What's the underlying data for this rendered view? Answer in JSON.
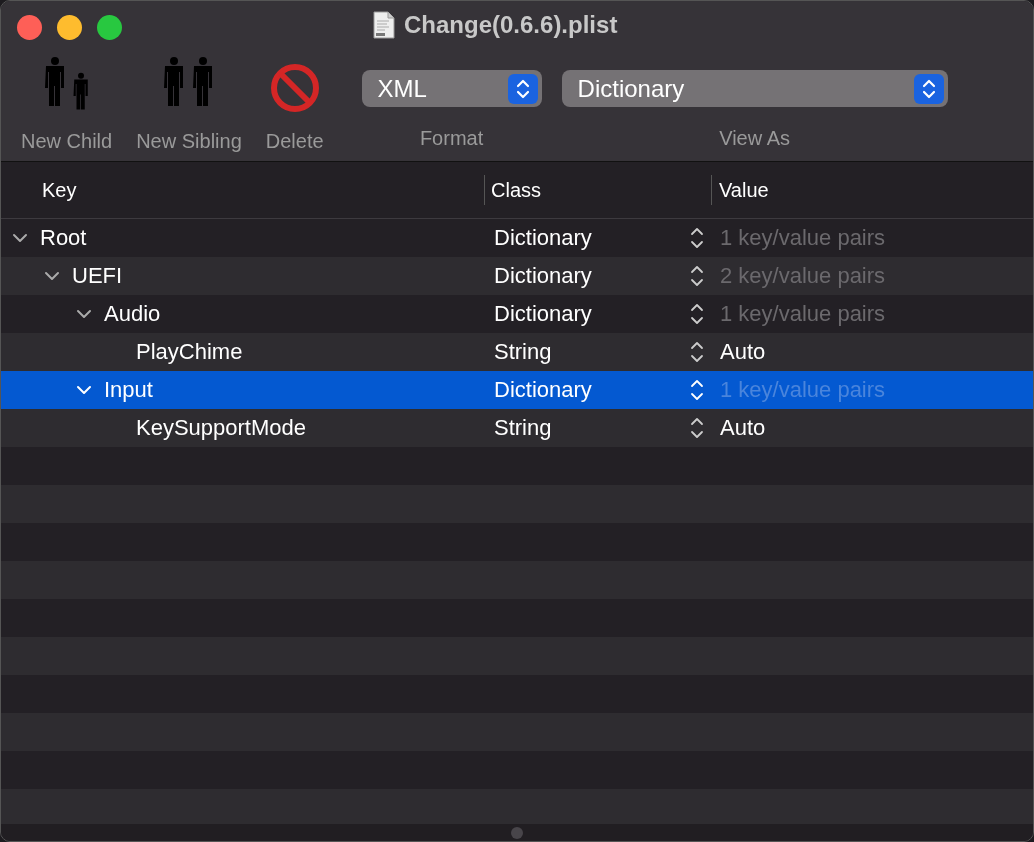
{
  "window": {
    "title": "Change(0.6.6).plist"
  },
  "toolbar": {
    "items": [
      {
        "kind": "child",
        "label": "New Child"
      },
      {
        "kind": "sibling",
        "label": "New Sibling"
      },
      {
        "kind": "delete",
        "label": "Delete"
      }
    ],
    "format": {
      "value": "XML",
      "label": "Format"
    },
    "view_as": {
      "value": "Dictionary",
      "label": "View As"
    }
  },
  "table": {
    "columns": [
      "Key",
      "Class",
      "Value"
    ],
    "rows": [
      {
        "key": "Root",
        "class": "Dictionary",
        "value": "1 key/value pairs",
        "kind": "dictionary",
        "expanded": true,
        "selected": false,
        "children": [
          {
            "key": "UEFI",
            "class": "Dictionary",
            "value": "2 key/value pairs",
            "kind": "dictionary",
            "expanded": true,
            "selected": false,
            "children": [
              {
                "key": "Audio",
                "class": "Dictionary",
                "value": "1 key/value pairs",
                "kind": "dictionary",
                "expanded": true,
                "selected": false,
                "children": [
                  {
                    "key": "PlayChime",
                    "class": "String",
                    "value": "Auto",
                    "kind": "string",
                    "selected": false
                  }
                ]
              },
              {
                "key": "Input",
                "class": "Dictionary",
                "value": "1 key/value pairs",
                "kind": "dictionary",
                "expanded": true,
                "selected": true,
                "children": [
                  {
                    "key": "KeySupportMode",
                    "class": "String",
                    "value": "Auto",
                    "kind": "string",
                    "selected": false
                  }
                ]
              }
            ]
          }
        ]
      }
    ]
  }
}
